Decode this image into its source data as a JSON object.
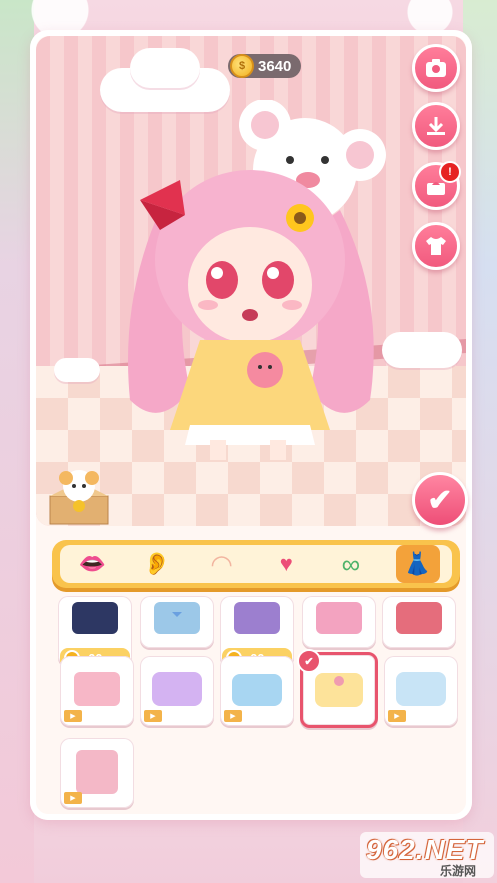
{
  "coins": {
    "amount": "3640",
    "icon": "coin-icon"
  },
  "side_buttons": [
    {
      "name": "camera-button",
      "icon": "camera-icon"
    },
    {
      "name": "download-button",
      "icon": "download-icon"
    },
    {
      "name": "gift-button",
      "icon": "gift-icon",
      "badge": "!"
    },
    {
      "name": "outfit-button",
      "icon": "tshirt-icon"
    }
  ],
  "confirm": {
    "label": "✔"
  },
  "categories": [
    {
      "name": "mouth",
      "icon": "mouth-icon",
      "glyph": "👄",
      "active": false
    },
    {
      "name": "ear",
      "icon": "ear-icon",
      "glyph": "👂",
      "active": false
    },
    {
      "name": "blush",
      "icon": "face-icon",
      "glyph": "◠",
      "active": false
    },
    {
      "name": "heart",
      "icon": "heart-icon",
      "glyph": "♥",
      "active": false
    },
    {
      "name": "glasses",
      "icon": "glasses-icon",
      "glyph": "∞",
      "active": false
    },
    {
      "name": "dress",
      "icon": "dress-icon",
      "glyph": "👗",
      "active": true
    }
  ],
  "items": [
    {
      "name": "outfit-1",
      "price": "60",
      "color": "#2d3763"
    },
    {
      "name": "outfit-2",
      "price": "",
      "color": "#9cc8e8"
    },
    {
      "name": "outfit-3",
      "price": "60",
      "color": "#9c7fcf"
    },
    {
      "name": "outfit-4",
      "price": "",
      "color": "#f3a3c0"
    },
    {
      "name": "outfit-5",
      "price": "",
      "color": "#e56d7c"
    },
    {
      "name": "outfit-6",
      "price": "",
      "color": "#f7b7c7",
      "ad": true
    },
    {
      "name": "outfit-7",
      "price": "",
      "color": "#d4b3f2",
      "ad": true
    },
    {
      "name": "outfit-8",
      "price": "",
      "color": "#a8d6f2",
      "ad": true
    },
    {
      "name": "outfit-9",
      "price": "",
      "color": "#fde39a",
      "selected": true
    },
    {
      "name": "outfit-10",
      "price": "",
      "color": "#c8e4f6",
      "ad": true
    },
    {
      "name": "outfit-11",
      "price": "",
      "color": "#f4b8c7",
      "ad": true
    }
  ],
  "watermark": {
    "text": "962.NET",
    "sub": "乐游网"
  }
}
